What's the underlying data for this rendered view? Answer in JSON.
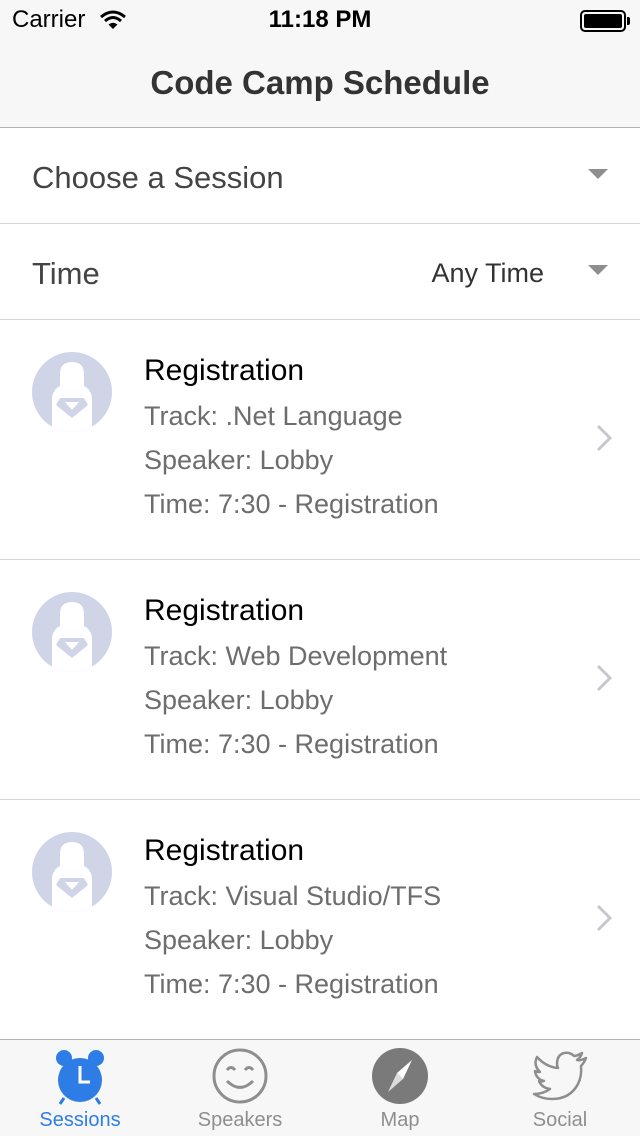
{
  "status_bar": {
    "carrier": "Carrier",
    "time": "11:18 PM"
  },
  "nav": {
    "title": "Code Camp Schedule"
  },
  "filters": {
    "session_picker": {
      "label": "Choose a Session"
    },
    "time_picker": {
      "label": "Time",
      "value": "Any Time"
    }
  },
  "sessions": [
    {
      "title": "Registration",
      "track": "Track: .Net Language",
      "speaker": "Speaker: Lobby",
      "time": "Time: 7:30 - Registration"
    },
    {
      "title": "Registration",
      "track": "Track: Web Development",
      "speaker": "Speaker: Lobby",
      "time": "Time: 7:30 - Registration"
    },
    {
      "title": "Registration",
      "track": "Track: Visual Studio/TFS",
      "speaker": "Speaker: Lobby",
      "time": "Time: 7:30 - Registration"
    }
  ],
  "tabs": [
    {
      "label": "Sessions",
      "icon": "alarm-clock-icon",
      "active": true
    },
    {
      "label": "Speakers",
      "icon": "smiley-face-icon",
      "active": false
    },
    {
      "label": "Map",
      "icon": "compass-icon",
      "active": false
    },
    {
      "label": "Social",
      "icon": "twitter-bird-icon",
      "active": false
    }
  ],
  "colors": {
    "accent": "#2e7de6",
    "inactive": "#8e8e8e",
    "bar_background": "#f7f7f7",
    "avatar_background": "#cfd4e6"
  }
}
